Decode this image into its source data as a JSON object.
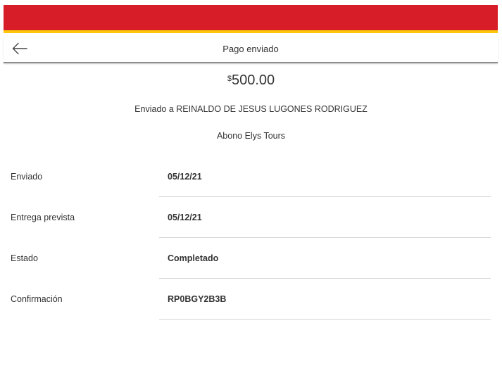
{
  "colors": {
    "banner_red": "#d71e28",
    "banner_gold": "#fcc60a"
  },
  "header": {
    "back_icon": "arrow-left-icon",
    "title": "Pago enviado"
  },
  "payment": {
    "currency_symbol": "$",
    "amount": "500.00",
    "recipient": "Enviado a REINALDO DE JESUS LUGONES RODRIGUEZ",
    "memo": "Abono Elys Tours"
  },
  "details": [
    {
      "label": "Enviado",
      "value": "05/12/21"
    },
    {
      "label": "Entrega prevista",
      "value": "05/12/21"
    },
    {
      "label": "Estado",
      "value": "Completado"
    },
    {
      "label": "Confirmación",
      "value": "RP0BGY2B3B"
    }
  ]
}
